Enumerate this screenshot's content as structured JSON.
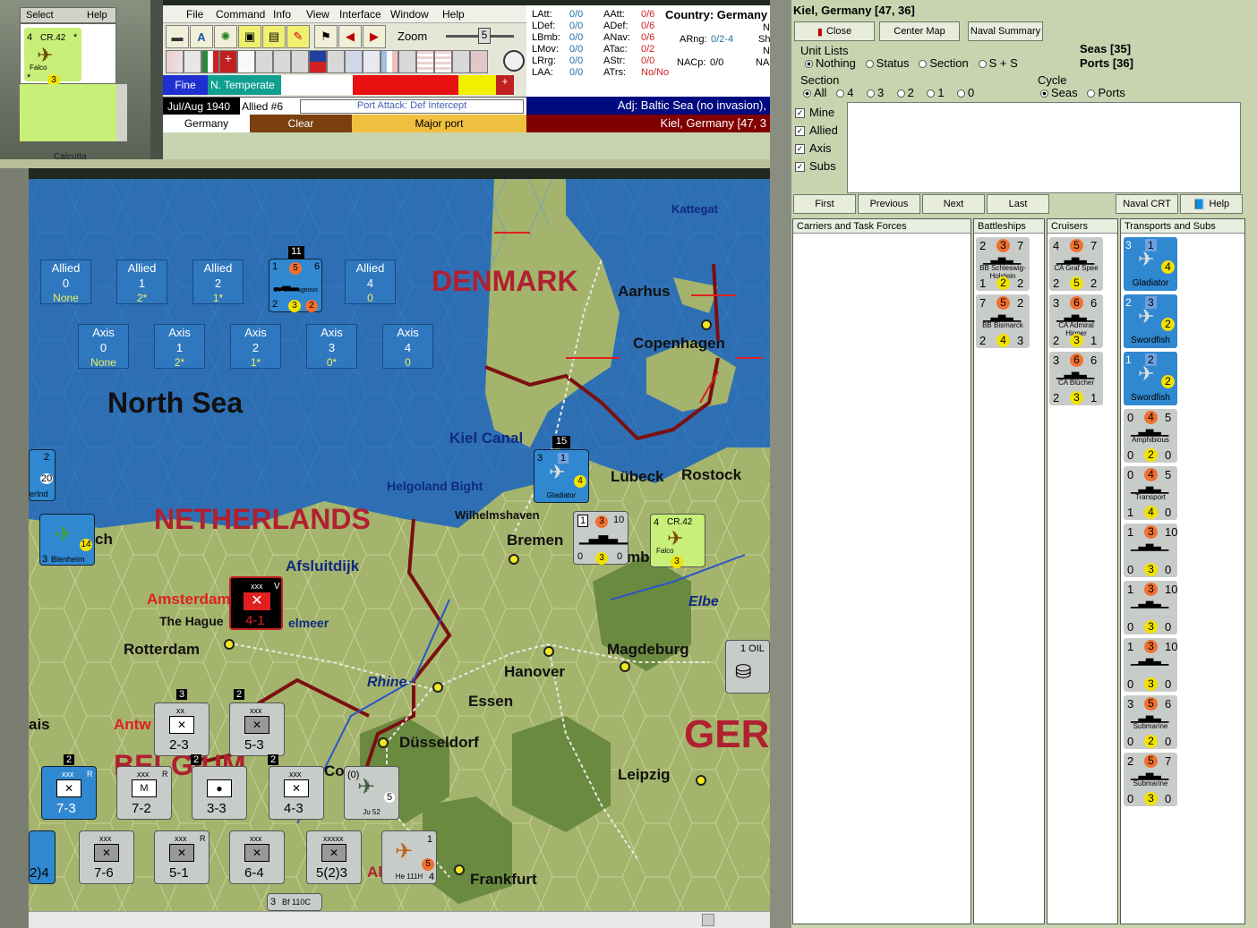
{
  "select_panel": {
    "select_label": "Select",
    "help_label": "Help",
    "unit_name": "CR.42",
    "unit_sub": "Falco",
    "unit_left": "4",
    "unit_bottom": "3",
    "unit_star1": "*",
    "unit_star2": "*",
    "mini_label": "Calcutta"
  },
  "menu": [
    "File",
    "Command",
    "Info",
    "View",
    "Interface",
    "Window",
    "Help"
  ],
  "toolbar": {
    "zoom_label": "Zoom",
    "zoom_value": "5"
  },
  "stats": {
    "col1": [
      [
        "LAtt:",
        "0/0"
      ],
      [
        "LDef:",
        "0/0"
      ],
      [
        "LBmb:",
        "0/0"
      ],
      [
        "LMov:",
        "0/0"
      ],
      [
        "LRrg:",
        "0/0"
      ],
      [
        "LAA:",
        "0/0"
      ]
    ],
    "col2": [
      [
        "AAtt:",
        "0/6"
      ],
      [
        "ADef:",
        "0/6"
      ],
      [
        "ANav:",
        "0/6"
      ],
      [
        "ATac:",
        "0/2"
      ],
      [
        "AStr:",
        "0/0"
      ],
      [
        "ATrs:",
        "No/No"
      ]
    ],
    "country_label": "Country: Germany",
    "arng": "ARng:",
    "arng_val": "0/2-4",
    "nacp": "NACp:",
    "nacp_val": "0/0",
    "edge": [
      "N",
      "Sh",
      "N",
      "NA"
    ]
  },
  "status": {
    "weather": "Fine",
    "zone": "N. Temperate",
    "date": "Jul/Aug 1940",
    "impulse": "Allied #6",
    "action": "Port Attack: Def Intercept",
    "adj": "Adj: Baltic Sea (no invasion),",
    "country": "Germany",
    "terrain": "Clear",
    "port": "Major port",
    "hex": "Kiel, Germany [47, 3"
  },
  "map": {
    "sea_title": "North Sea",
    "countries": [
      "DENMARK",
      "NETHERLANDS",
      "BELGIUM",
      "GER"
    ],
    "waters": [
      "Kattegat",
      "Kiel Canal",
      "Helgoland Bight",
      "Afsluitdijk",
      "Elbe",
      "Rhine"
    ],
    "cities": [
      "Aarhus",
      "Copenhagen",
      "Lübeck",
      "Rostock",
      "Wilhelmshaven",
      "Bremen",
      "Amsterdam",
      "The Hague",
      "Rotterdam",
      "Hanover",
      "Magdeburg",
      "Essen",
      "Düsseldorf",
      "Leipzig",
      "Frankfurt",
      "Antw",
      "ais",
      "Co",
      "Al",
      "ch",
      "mb",
      "elmeer"
    ],
    "allied_boxes": [
      {
        "side": "Allied",
        "num": "0",
        "val": "None"
      },
      {
        "side": "Allied",
        "num": "1",
        "val": "2*"
      },
      {
        "side": "Allied",
        "num": "2",
        "val": "1*"
      },
      {
        "side": "Allied",
        "num": "4",
        "val": "0"
      }
    ],
    "axis_boxes": [
      {
        "side": "Axis",
        "num": "0",
        "val": "None"
      },
      {
        "side": "Axis",
        "num": "1",
        "val": "2*"
      },
      {
        "side": "Axis",
        "num": "2",
        "val": "1*"
      },
      {
        "side": "Axis",
        "num": "3",
        "val": "0*"
      },
      {
        "side": "Axis",
        "num": "4",
        "val": "0"
      }
    ],
    "carrier": {
      "top": "11",
      "a": "1",
      "b": "5",
      "c": "6",
      "name": "CV Courageous",
      "d": "2",
      "e": "3",
      "f": "2"
    },
    "stack15": "15",
    "gladiator": {
      "a": "3",
      "b": "1",
      "name": "Gladiator",
      "c": "4"
    },
    "ships": {
      "a": "1",
      "b": "3",
      "c": "10",
      "d": "0",
      "e": "3",
      "f": "0"
    },
    "cr42": {
      "a": "4",
      "name": "CR.42",
      "sub": "Falco",
      "b": "3"
    },
    "blenheim": {
      "a": "3",
      "name": "Blenheim",
      "b": "14"
    },
    "left_air": {
      "a": "2",
      "b": "20",
      "c": "1",
      "name": "erInd"
    },
    "oil": "1 OIL",
    "red_unit": {
      "type": "xxx",
      "v": "V",
      "val": "4-1"
    },
    "units_row1": [
      {
        "top": "3",
        "size": "xx",
        "val": "2-3",
        "name": "2nd Inf Div"
      },
      {
        "top": "2",
        "size": "xxx",
        "val": "5-3",
        "name": "XXXIV Inf"
      }
    ],
    "units_row2": [
      {
        "top": "2",
        "size": "xxx",
        "r": "R",
        "val": "7-3",
        "name": "II Inf"
      },
      {
        "top": "",
        "size": "xxx",
        "r": "R",
        "val": "7-2",
        "name": "I Pz"
      },
      {
        "top": "2",
        "size": "",
        "val": "3-3",
        "name": "105 mm"
      },
      {
        "top": "2",
        "size": "xxx",
        "val": "4-3",
        "name": "II Para"
      }
    ],
    "ju52": {
      "a": "(0)",
      "b": "5",
      "name": "Ju 52"
    },
    "units_row3": [
      {
        "size": "xxx",
        "val": "7-6",
        "name": "VIII Mech"
      },
      {
        "size": "xxx",
        "r": "R",
        "val": "5-1",
        "name": "XXXV Gar"
      },
      {
        "size": "xxx",
        "val": "6-4",
        "name": "XII Inf"
      },
      {
        "size": "xxxxx",
        "val": "5(2)3",
        "name": "Von Leeb"
      }
    ],
    "he111": {
      "a": "1",
      "b": "5",
      "name": "He 111H",
      "c": "4"
    },
    "bf110": {
      "a": "3",
      "name": "Bf 110C"
    },
    "left_row3": "2)4"
  },
  "right_panel": {
    "title": "Kiel, Germany [47, 36]",
    "close": "Close",
    "center": "Center Map",
    "naval_summary": "Naval Summary",
    "seas": "Seas [35]",
    "ports": "Ports [36]",
    "unit_lists_label": "Unit Lists",
    "unit_lists": [
      "Nothing",
      "Status",
      "Section",
      "S + S"
    ],
    "section_label": "Section",
    "sections": [
      "All",
      "4",
      "3",
      "2",
      "1",
      "0"
    ],
    "cycle_label": "Cycle",
    "cycle": [
      "Seas",
      "Ports"
    ],
    "checks": [
      "Mine",
      "Allied",
      "Axis",
      "Subs"
    ],
    "nav": [
      "First",
      "Previous",
      "Next",
      "Last"
    ],
    "naval_crt": "Naval CRT",
    "help": "Help",
    "columns": [
      "Carriers and Task Forces",
      "Battleships",
      "Cruisers",
      "Transports and Subs"
    ],
    "battleships": [
      {
        "a": "2",
        "b": "3",
        "c": "7",
        "name": "BB Schleswig-Holstein",
        "d": "1",
        "e": "2",
        "f": "2"
      },
      {
        "a": "7",
        "b": "5",
        "c": "2",
        "name": "BB Bismarck",
        "d": "2",
        "e": "4",
        "f": "3"
      }
    ],
    "cruisers": [
      {
        "a": "4",
        "b": "5",
        "c": "7",
        "name": "CA Graf Spee",
        "d": "2",
        "e": "5",
        "f": "2"
      },
      {
        "a": "3",
        "b": "6",
        "c": "6",
        "name": "CA Admiral Hipper",
        "d": "2",
        "e": "3",
        "f": "1"
      },
      {
        "a": "3",
        "b": "6",
        "c": "6",
        "name": "CA Blücher",
        "d": "2",
        "e": "3",
        "f": "1"
      }
    ],
    "transports": [
      {
        "a": "3",
        "b": "1",
        "name": "Gladiator",
        "c": "4",
        "kind": "air"
      },
      {
        "a": "2",
        "b": "3",
        "name": "Swordfish",
        "c": "2",
        "kind": "air"
      },
      {
        "a": "1",
        "b": "2",
        "name": "Swordfish",
        "c": "2",
        "kind": "air"
      },
      {
        "a": "0",
        "b": "4",
        "c": "5",
        "name": "Amphibious",
        "d": "0",
        "e": "2",
        "f": "0",
        "kind": "ship"
      },
      {
        "a": "0",
        "b": "4",
        "c": "5",
        "name": "Transport",
        "d": "1",
        "e": "4",
        "f": "0",
        "kind": "ship"
      },
      {
        "a": "1",
        "b": "3",
        "c": "10",
        "name": "",
        "d": "0",
        "e": "3",
        "f": "0",
        "kind": "ship"
      },
      {
        "a": "1",
        "b": "3",
        "c": "10",
        "name": "",
        "d": "0",
        "e": "3",
        "f": "0",
        "kind": "ship"
      },
      {
        "a": "1",
        "b": "3",
        "c": "10",
        "name": "",
        "d": "0",
        "e": "3",
        "f": "0",
        "kind": "ship"
      },
      {
        "a": "3",
        "b": "5",
        "c": "6",
        "name": "Submarine",
        "d": "0",
        "e": "2",
        "f": "0",
        "kind": "ship"
      },
      {
        "a": "2",
        "b": "5",
        "c": "7",
        "name": "Submarine",
        "d": "0",
        "e": "3",
        "f": "0",
        "kind": "ship"
      }
    ]
  },
  "colors": {
    "sea": "#2e6fb4",
    "land": "#a8b870",
    "border": "#7a1010",
    "panel": "#c8d4b0",
    "allied_blue": "#3088d0"
  }
}
